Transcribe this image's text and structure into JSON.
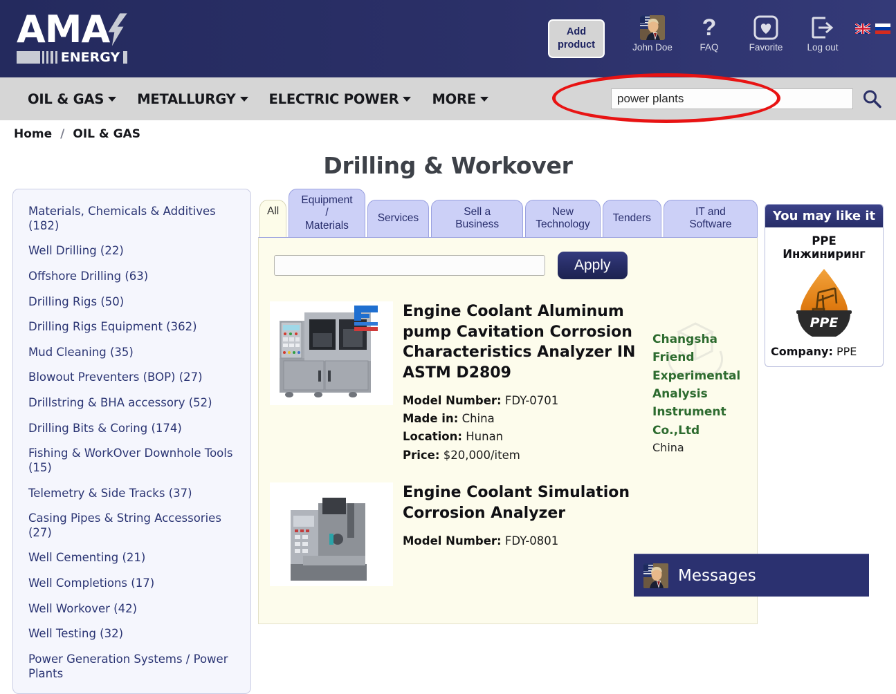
{
  "header": {
    "logo": {
      "main_text": "AMA",
      "sub_text": "ENERGY",
      "bolt_icon": "lightning-bolt-icon"
    },
    "add_product_label": "Add\nproduct",
    "items": [
      {
        "label": "John Doe",
        "icon": "user-avatar"
      },
      {
        "label": "FAQ",
        "icon": "question-mark-icon"
      },
      {
        "label": "Favorite",
        "icon": "heart-icon"
      },
      {
        "label": "Log out",
        "icon": "logout-arrow-icon"
      }
    ],
    "flags": [
      {
        "name": "uk-flag-icon",
        "title": "English"
      },
      {
        "name": "russia-flag-icon",
        "title": "Russian"
      }
    ]
  },
  "nav": {
    "items": [
      {
        "label": "OIL & GAS",
        "has_dropdown": true
      },
      {
        "label": "METALLURGY",
        "has_dropdown": true
      },
      {
        "label": "ELECTRIC POWER",
        "has_dropdown": true
      },
      {
        "label": "MORE",
        "has_dropdown": true
      }
    ],
    "search": {
      "value": "power plants",
      "placeholder": "",
      "icon": "search-icon"
    }
  },
  "breadcrumb": {
    "home": "Home",
    "separator": "/",
    "current": "OIL & GAS"
  },
  "page": {
    "title": "Drilling & Workover"
  },
  "sidebar": {
    "items": [
      "Materials, Chemicals & Additives (182)",
      "Well Drilling (22)",
      "Offshore Drilling (63)",
      "Drilling Rigs (50)",
      "Drilling Rigs Equipment (362)",
      "Mud Cleaning (35)",
      "Blowout Preventers (BOP) (27)",
      "Drillstring & BHA accessory (52)",
      "Drilling Bits & Coring (174)",
      "Fishing & WorkOver Downhole Tools (15)",
      "Telemetry & Side Tracks (37)",
      "Casing Pipes & String Accessories (27)",
      "Well Cementing (21)",
      "Well Completions (17)",
      "Well Workover (42)",
      "Well Testing (32)",
      "Power Generation Systems / Power Plants"
    ]
  },
  "main": {
    "tabs": [
      {
        "label": "All",
        "active": true
      },
      {
        "label": "Equipment /\nMaterials",
        "active": false
      },
      {
        "label": "Services",
        "active": false
      },
      {
        "label": "Sell a Business",
        "active": false
      },
      {
        "label": "New\nTechnology",
        "active": false
      },
      {
        "label": "Tenders",
        "active": false
      },
      {
        "label": "IT and Software",
        "active": false
      }
    ],
    "filter": {
      "value": "",
      "placeholder": "",
      "apply_label": "Apply"
    },
    "products": [
      {
        "title": "Engine Coolant Aluminum pump Cavitation Corrosion Characteristics Analyzer IN ASTM D2809",
        "attrs": [
          {
            "label": "Model Number:",
            "value": "FDY-0701"
          },
          {
            "label": "Made in:",
            "value": "China"
          },
          {
            "label": "Location:",
            "value": "Hunan"
          },
          {
            "label": "Price:",
            "value": "$20,000/item"
          }
        ],
        "seller": "Changsha Friend Experimental Analysis Instrument Co.,Ltd",
        "seller_country": "China",
        "image_alt": "laboratory-analyzer-photo"
      },
      {
        "title": "Engine Coolant Simulation Corrosion Analyzer",
        "attrs": [
          {
            "label": "Model Number:",
            "value": "FDY-0801"
          }
        ],
        "seller": "",
        "seller_country": "",
        "image_alt": "corrosion-analyzer-photo"
      }
    ]
  },
  "rightbar": {
    "like_title": "You may like it",
    "company_name": "PPE Инжиниринг",
    "logo_text": "PPE",
    "company_label": "Company:",
    "company_value": "PPE"
  },
  "messages": {
    "label": "Messages",
    "avatar": "user-avatar"
  },
  "colors": {
    "header_navy": "#2b3068",
    "nav_gray": "#d6d6d6",
    "panel_cream": "#fdfcec",
    "sidebar_blue": "#f5f6fd",
    "link_navy": "#2a3473",
    "seller_green": "#2d6b2f",
    "annotation_red": "#e81313",
    "ppe_orange": "#e88b1d"
  }
}
